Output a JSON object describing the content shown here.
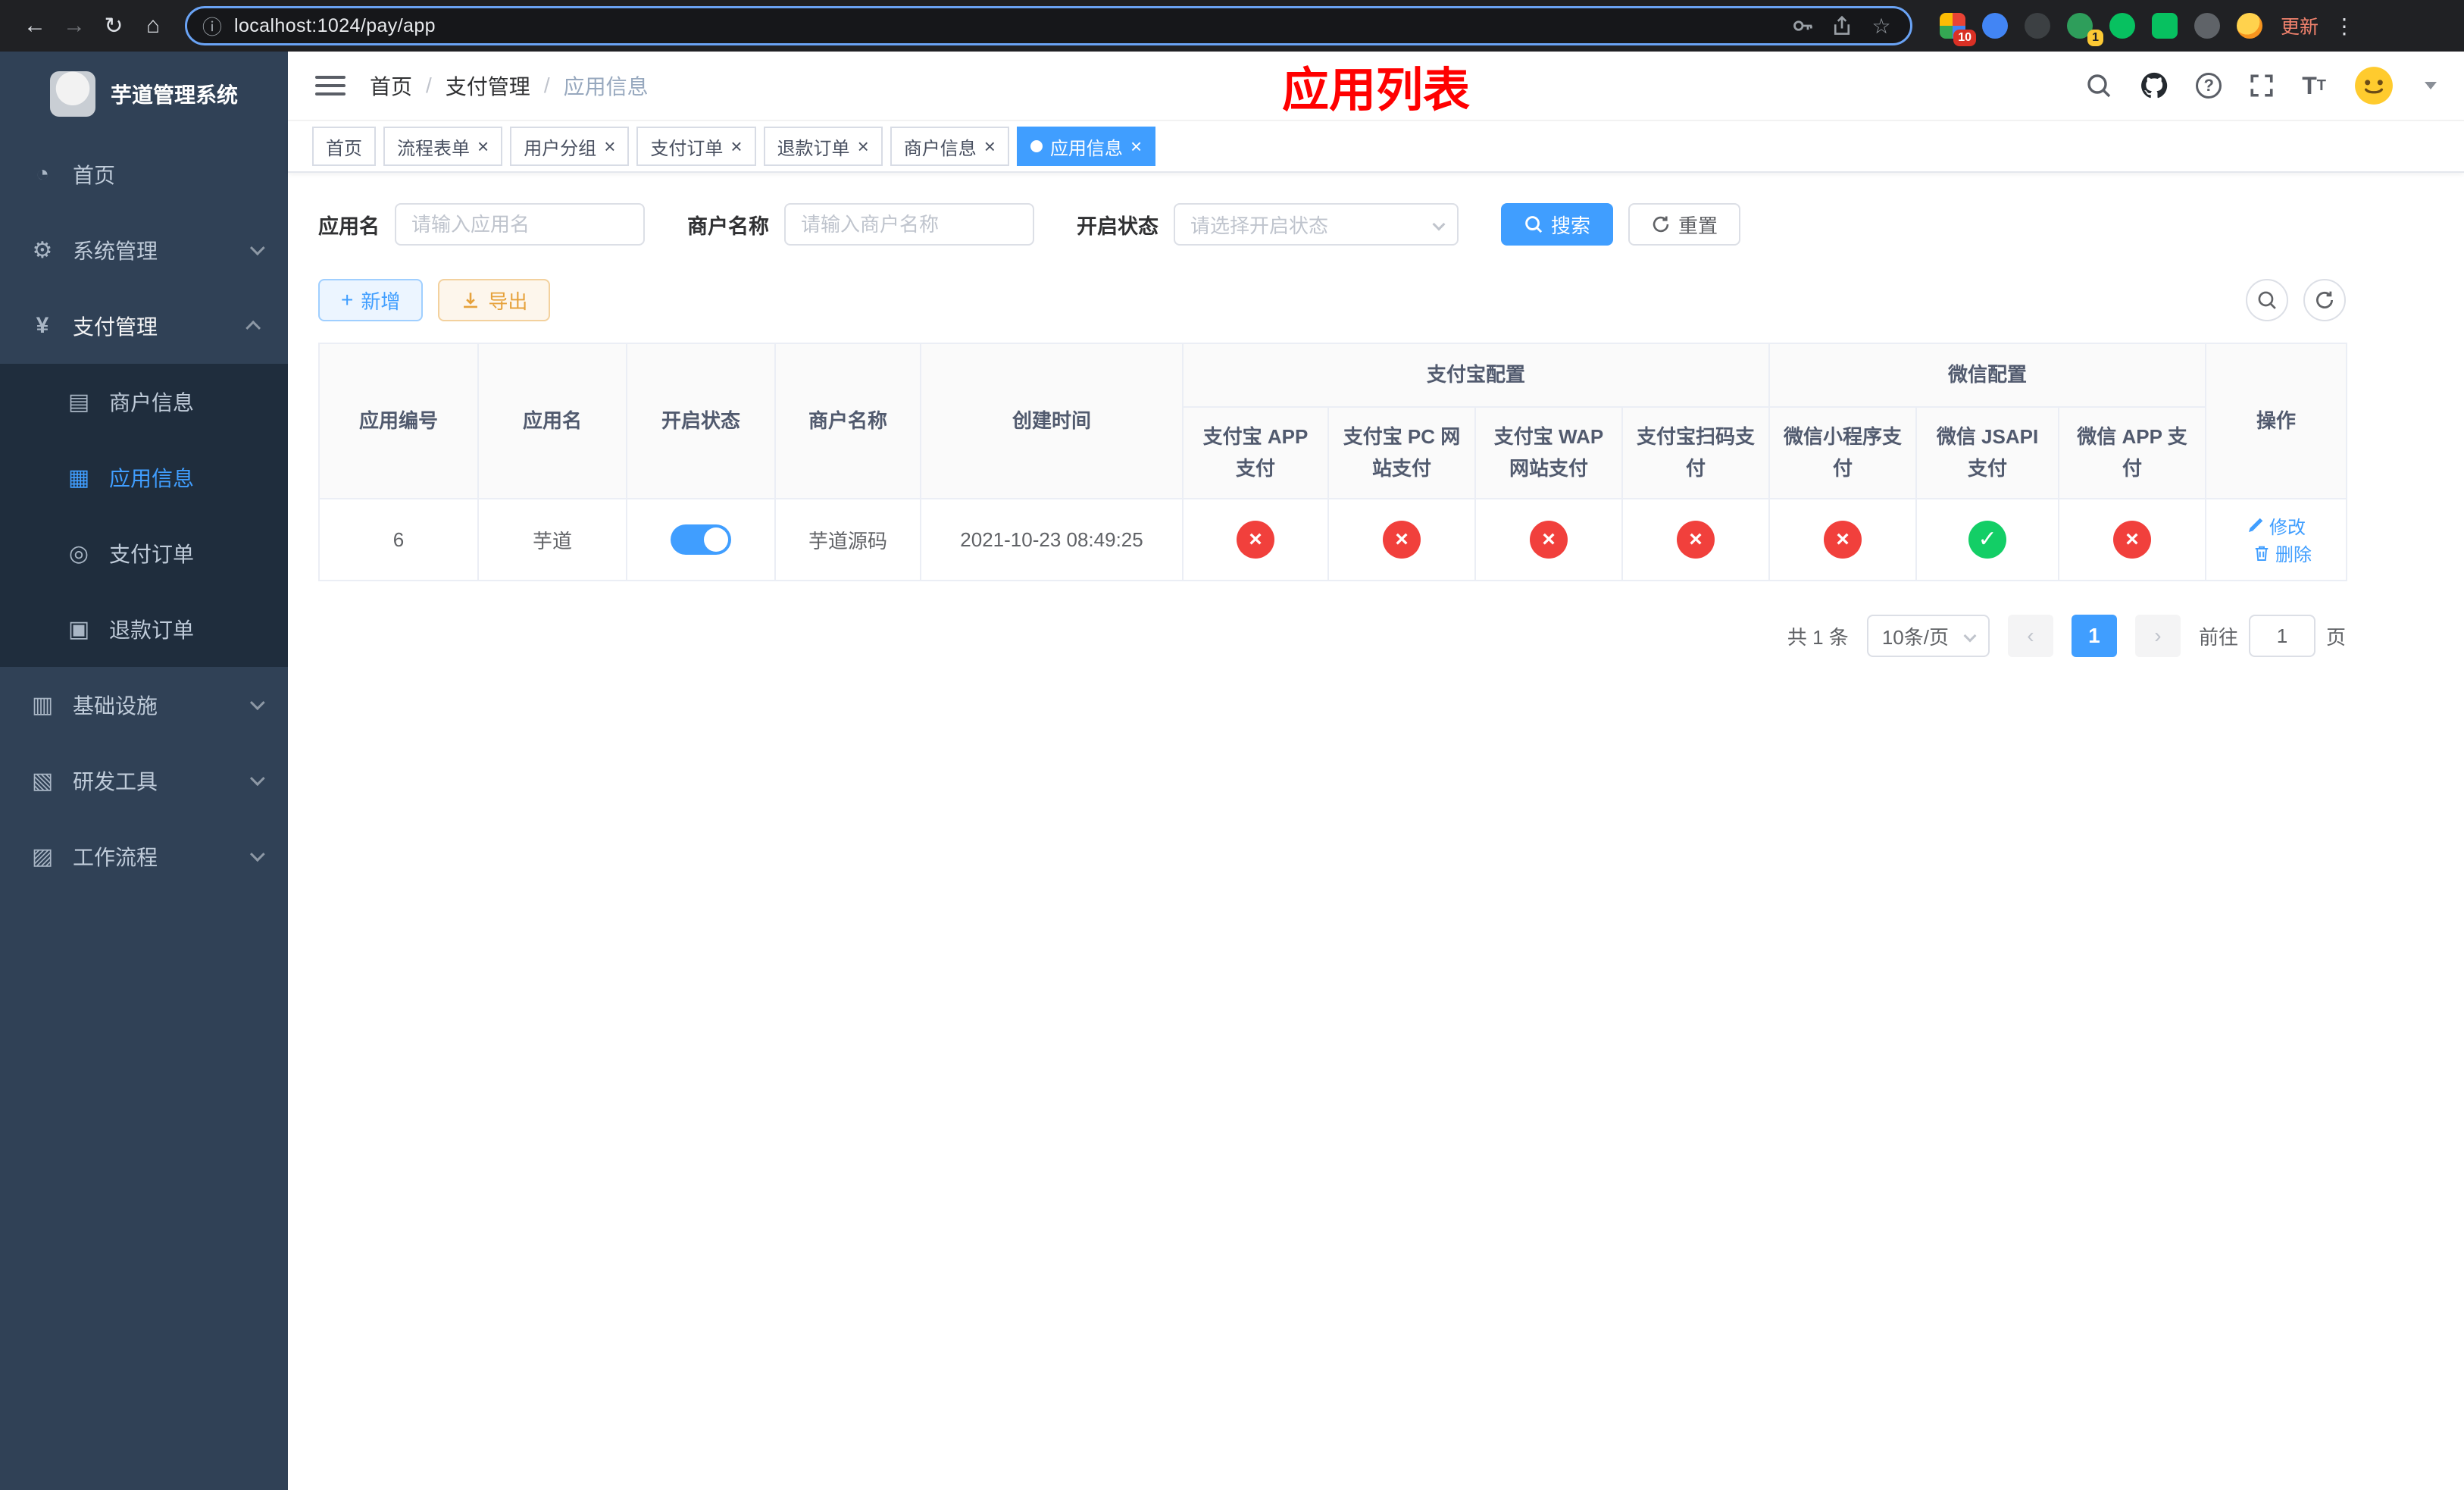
{
  "browser": {
    "url": "localhost:1024/pay/app",
    "update_label": "更新",
    "extension_badge_1": "10",
    "extension_badge_2": "1"
  },
  "sidebar": {
    "app_title": "芋道管理系统",
    "menu": [
      {
        "label": "首页"
      },
      {
        "label": "系统管理"
      },
      {
        "label": "支付管理"
      },
      {
        "label": "商户信息"
      },
      {
        "label": "应用信息"
      },
      {
        "label": "支付订单"
      },
      {
        "label": "退款订单"
      },
      {
        "label": "基础设施"
      },
      {
        "label": "研发工具"
      },
      {
        "label": "工作流程"
      }
    ]
  },
  "header": {
    "breadcrumb_home": "首页",
    "breadcrumb_parent": "支付管理",
    "breadcrumb_current": "应用信息",
    "page_title": "应用列表"
  },
  "tabs": [
    {
      "label": "首页"
    },
    {
      "label": "流程表单"
    },
    {
      "label": "用户分组"
    },
    {
      "label": "支付订单"
    },
    {
      "label": "退款订单"
    },
    {
      "label": "商户信息"
    },
    {
      "label": "应用信息"
    }
  ],
  "filters": {
    "app_name_label": "应用名",
    "app_name_placeholder": "请输入应用名",
    "merchant_label": "商户名称",
    "merchant_placeholder": "请输入商户名称",
    "status_label": "开启状态",
    "status_placeholder": "请选择开启状态",
    "search_label": "搜索",
    "reset_label": "重置"
  },
  "toolbar": {
    "add_label": "新增",
    "export_label": "导出"
  },
  "table": {
    "group_alipay": "支付宝配置",
    "group_wechat": "微信配置",
    "columns": [
      "应用编号",
      "应用名",
      "开启状态",
      "商户名称",
      "创建时间",
      "支付宝 APP 支付",
      "支付宝 PC 网站支付",
      "支付宝 WAP 网站支付",
      "支付宝扫码支付",
      "微信小程序支付",
      "微信 JSAPI 支付",
      "微信 APP 支付",
      "操作"
    ],
    "rows": [
      {
        "id": "6",
        "name": "芋道",
        "enabled": true,
        "merchant": "芋道源码",
        "created": "2021-10-23 08:49:25",
        "statuses": [
          "error",
          "error",
          "error",
          "error",
          "error",
          "success",
          "error"
        ],
        "edit_label": "修改",
        "delete_label": "删除"
      }
    ]
  },
  "pagination": {
    "total_text": "共 1 条",
    "page_size_text": "10条/页",
    "current_page": "1",
    "goto_label": "前往",
    "goto_value": "1",
    "page_unit": "页"
  },
  "colors": {
    "primary": "#409eff",
    "error": "#f1403c",
    "success": "#13ce66",
    "title_red": "#ff0000",
    "sidebar_bg": "#304156",
    "submenu_bg": "#1f2d3d"
  }
}
